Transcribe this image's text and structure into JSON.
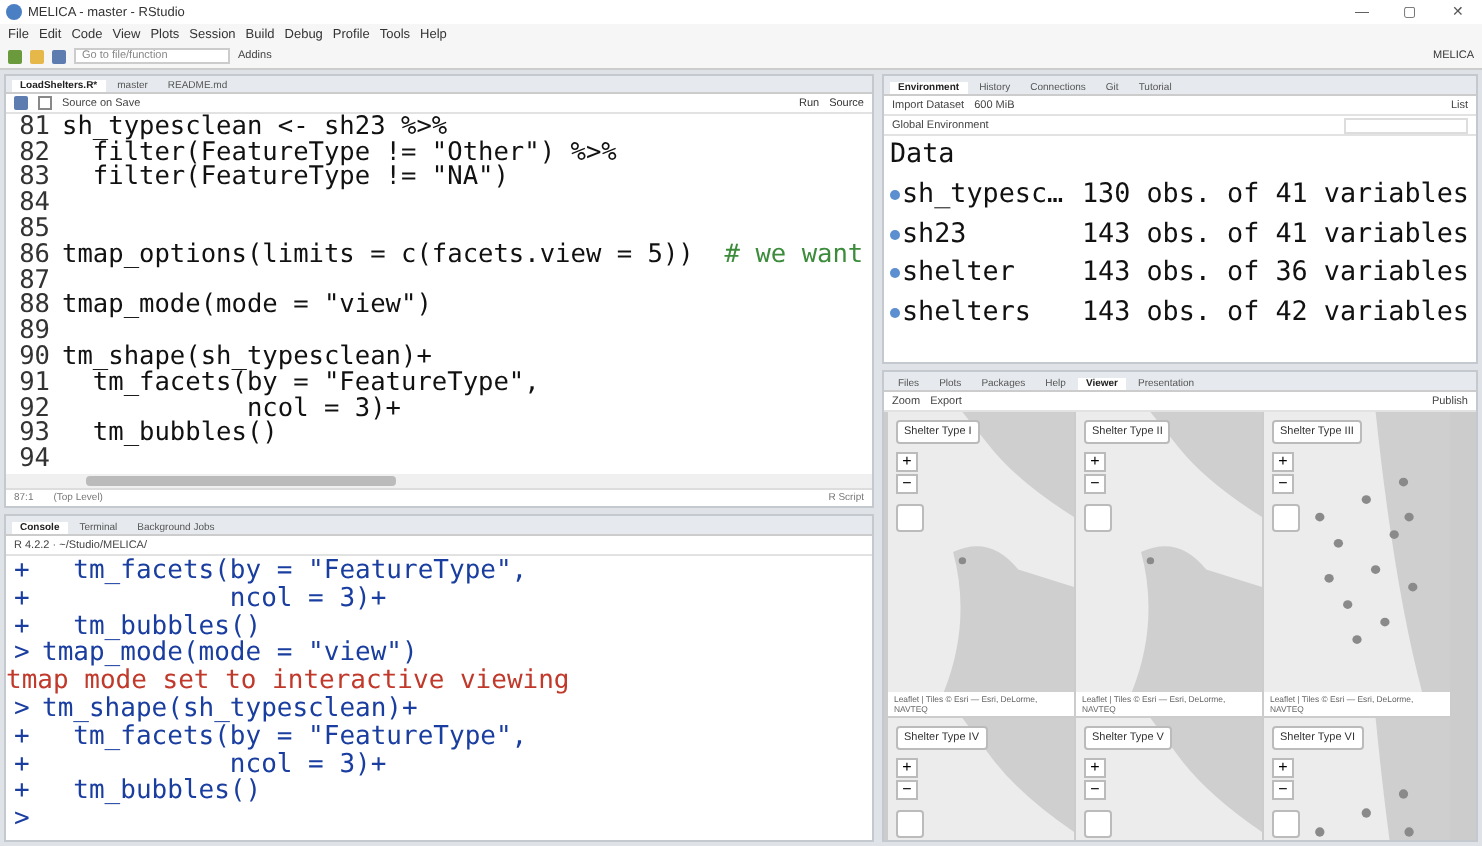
{
  "window": {
    "title": "MELICA - master - RStudio",
    "controls": [
      "—",
      "▢",
      "✕"
    ]
  },
  "menu": [
    "File",
    "Edit",
    "Code",
    "View",
    "Plots",
    "Session",
    "Build",
    "Debug",
    "Profile",
    "Tools",
    "Help"
  ],
  "toolbar": {
    "goto_placeholder": "Go to file/function",
    "addins": "Addins",
    "project": "MELICA"
  },
  "editor": {
    "tabs": [
      {
        "label": "LoadShelters.R*",
        "selected": true
      },
      {
        "label": "master",
        "selected": false
      },
      {
        "label": "README.md",
        "selected": false
      }
    ],
    "source_on_save": "Source on Save",
    "source_on_save_checked": false,
    "run": "Run",
    "source": "Source",
    "lines": [
      {
        "num": "81",
        "code": "sh_typesclean <- sh23 %>%"
      },
      {
        "num": "82",
        "code": "  filter(FeatureType != \"Other\") %>%"
      },
      {
        "num": "83",
        "code": "  filter(FeatureType != \"NA\")"
      },
      {
        "num": "84"
      },
      {
        "num": "85"
      },
      {
        "num": "86",
        "code": "tmap_options(limits = c(facets.view = 5))  ",
        "comment": "# we want"
      },
      {
        "num": "87"
      },
      {
        "num": "88",
        "code": "tmap_mode(mode = \"view\")"
      },
      {
        "num": "89"
      },
      {
        "num": "90",
        "code": "tm_shape(sh_typesclean)+"
      },
      {
        "num": "91",
        "code": "  tm_facets(by = \"FeatureType\","
      },
      {
        "num": "92",
        "code": "            ncol = 3)+"
      },
      {
        "num": "93",
        "code": "  tm_bubbles()"
      },
      {
        "num": "94"
      }
    ],
    "status": {
      "position": "87:1",
      "scope": "(Top Level)",
      "type": "R Script"
    }
  },
  "console": {
    "tabs": [
      {
        "label": "Console",
        "selected": true
      },
      {
        "label": "Terminal",
        "selected": false
      },
      {
        "label": "Background Jobs",
        "selected": false
      }
    ],
    "path": "R 4.2.2 · ~/Studio/MELICA/",
    "lines": [
      {
        "kind": "cont",
        "prompt": "+",
        "text": "  tm_facets(by = \"FeatureType\","
      },
      {
        "kind": "cont",
        "prompt": "+",
        "text": "            ncol = 3)+"
      },
      {
        "kind": "cont",
        "prompt": "+",
        "text": "  tm_bubbles()"
      },
      {
        "kind": "input",
        "prompt": ">",
        "text": "tmap_mode(mode = \"view\")"
      },
      {
        "kind": "message",
        "text": "tmap mode set to interactive viewing"
      },
      {
        "kind": "input",
        "prompt": ">",
        "text": "tm_shape(sh_typesclean)+"
      },
      {
        "kind": "cont",
        "prompt": "+",
        "text": "  tm_facets(by = \"FeatureType\","
      },
      {
        "kind": "cont",
        "prompt": "+",
        "text": "            ncol = 3)+"
      },
      {
        "kind": "cont",
        "prompt": "+",
        "text": "  tm_bubbles()"
      },
      {
        "kind": "input",
        "prompt": ">"
      }
    ]
  },
  "environment": {
    "tabs": [
      {
        "label": "Environment",
        "selected": true
      },
      {
        "label": "History",
        "selected": false
      },
      {
        "label": "Connections",
        "selected": false
      },
      {
        "label": "Git",
        "selected": false
      },
      {
        "label": "Tutorial",
        "selected": false
      }
    ],
    "import": "Import Dataset",
    "memory": "600 MiB",
    "view": "List",
    "scope": "Global Environment",
    "heading": "Data",
    "rows": [
      {
        "name": "sh_typesc…",
        "info": "130 obs. of 41 variables"
      },
      {
        "name": "sh23",
        "info": "143 obs. of 41 variables"
      },
      {
        "name": "shelter",
        "info": "143 obs. of 36 variables"
      },
      {
        "name": "shelters",
        "info": "143 obs. of 42 variables"
      }
    ]
  },
  "viewer": {
    "tabs": [
      {
        "label": "Files",
        "selected": false
      },
      {
        "label": "Plots",
        "selected": false
      },
      {
        "label": "Packages",
        "selected": false
      },
      {
        "label": "Help",
        "selected": false
      },
      {
        "label": "Viewer",
        "selected": true
      },
      {
        "label": "Presentation",
        "selected": false
      }
    ],
    "zoom": "Zoom",
    "export": "Export",
    "publish": "Publish",
    "maps": [
      {
        "title": "Shelter Type I",
        "zoom_in": "+",
        "zoom_out": "−",
        "attribution": "Leaflet | Tiles © Esri — Esri, DeLorme,",
        "attribution_2": "NAVTEQ"
      },
      {
        "title": "Shelter Type II",
        "zoom_in": "+",
        "zoom_out": "−",
        "attribution": "Leaflet | Tiles © Esri — Esri, DeLorme,",
        "attribution_2": "NAVTEQ"
      },
      {
        "title": "Shelter Type III",
        "zoom_in": "+",
        "zoom_out": "−",
        "attribution": "Leaflet | Tiles © Esri — Esri, DeLorme,",
        "attribution_2": "NAVTEQ"
      },
      {
        "title": "Shelter Type IV",
        "zoom_in": "+",
        "zoom_out": "−"
      },
      {
        "title": "Shelter Type V",
        "zoom_in": "+",
        "zoom_out": "−"
      },
      {
        "title": "Shelter Type VI",
        "zoom_in": "+",
        "zoom_out": "−"
      }
    ]
  }
}
